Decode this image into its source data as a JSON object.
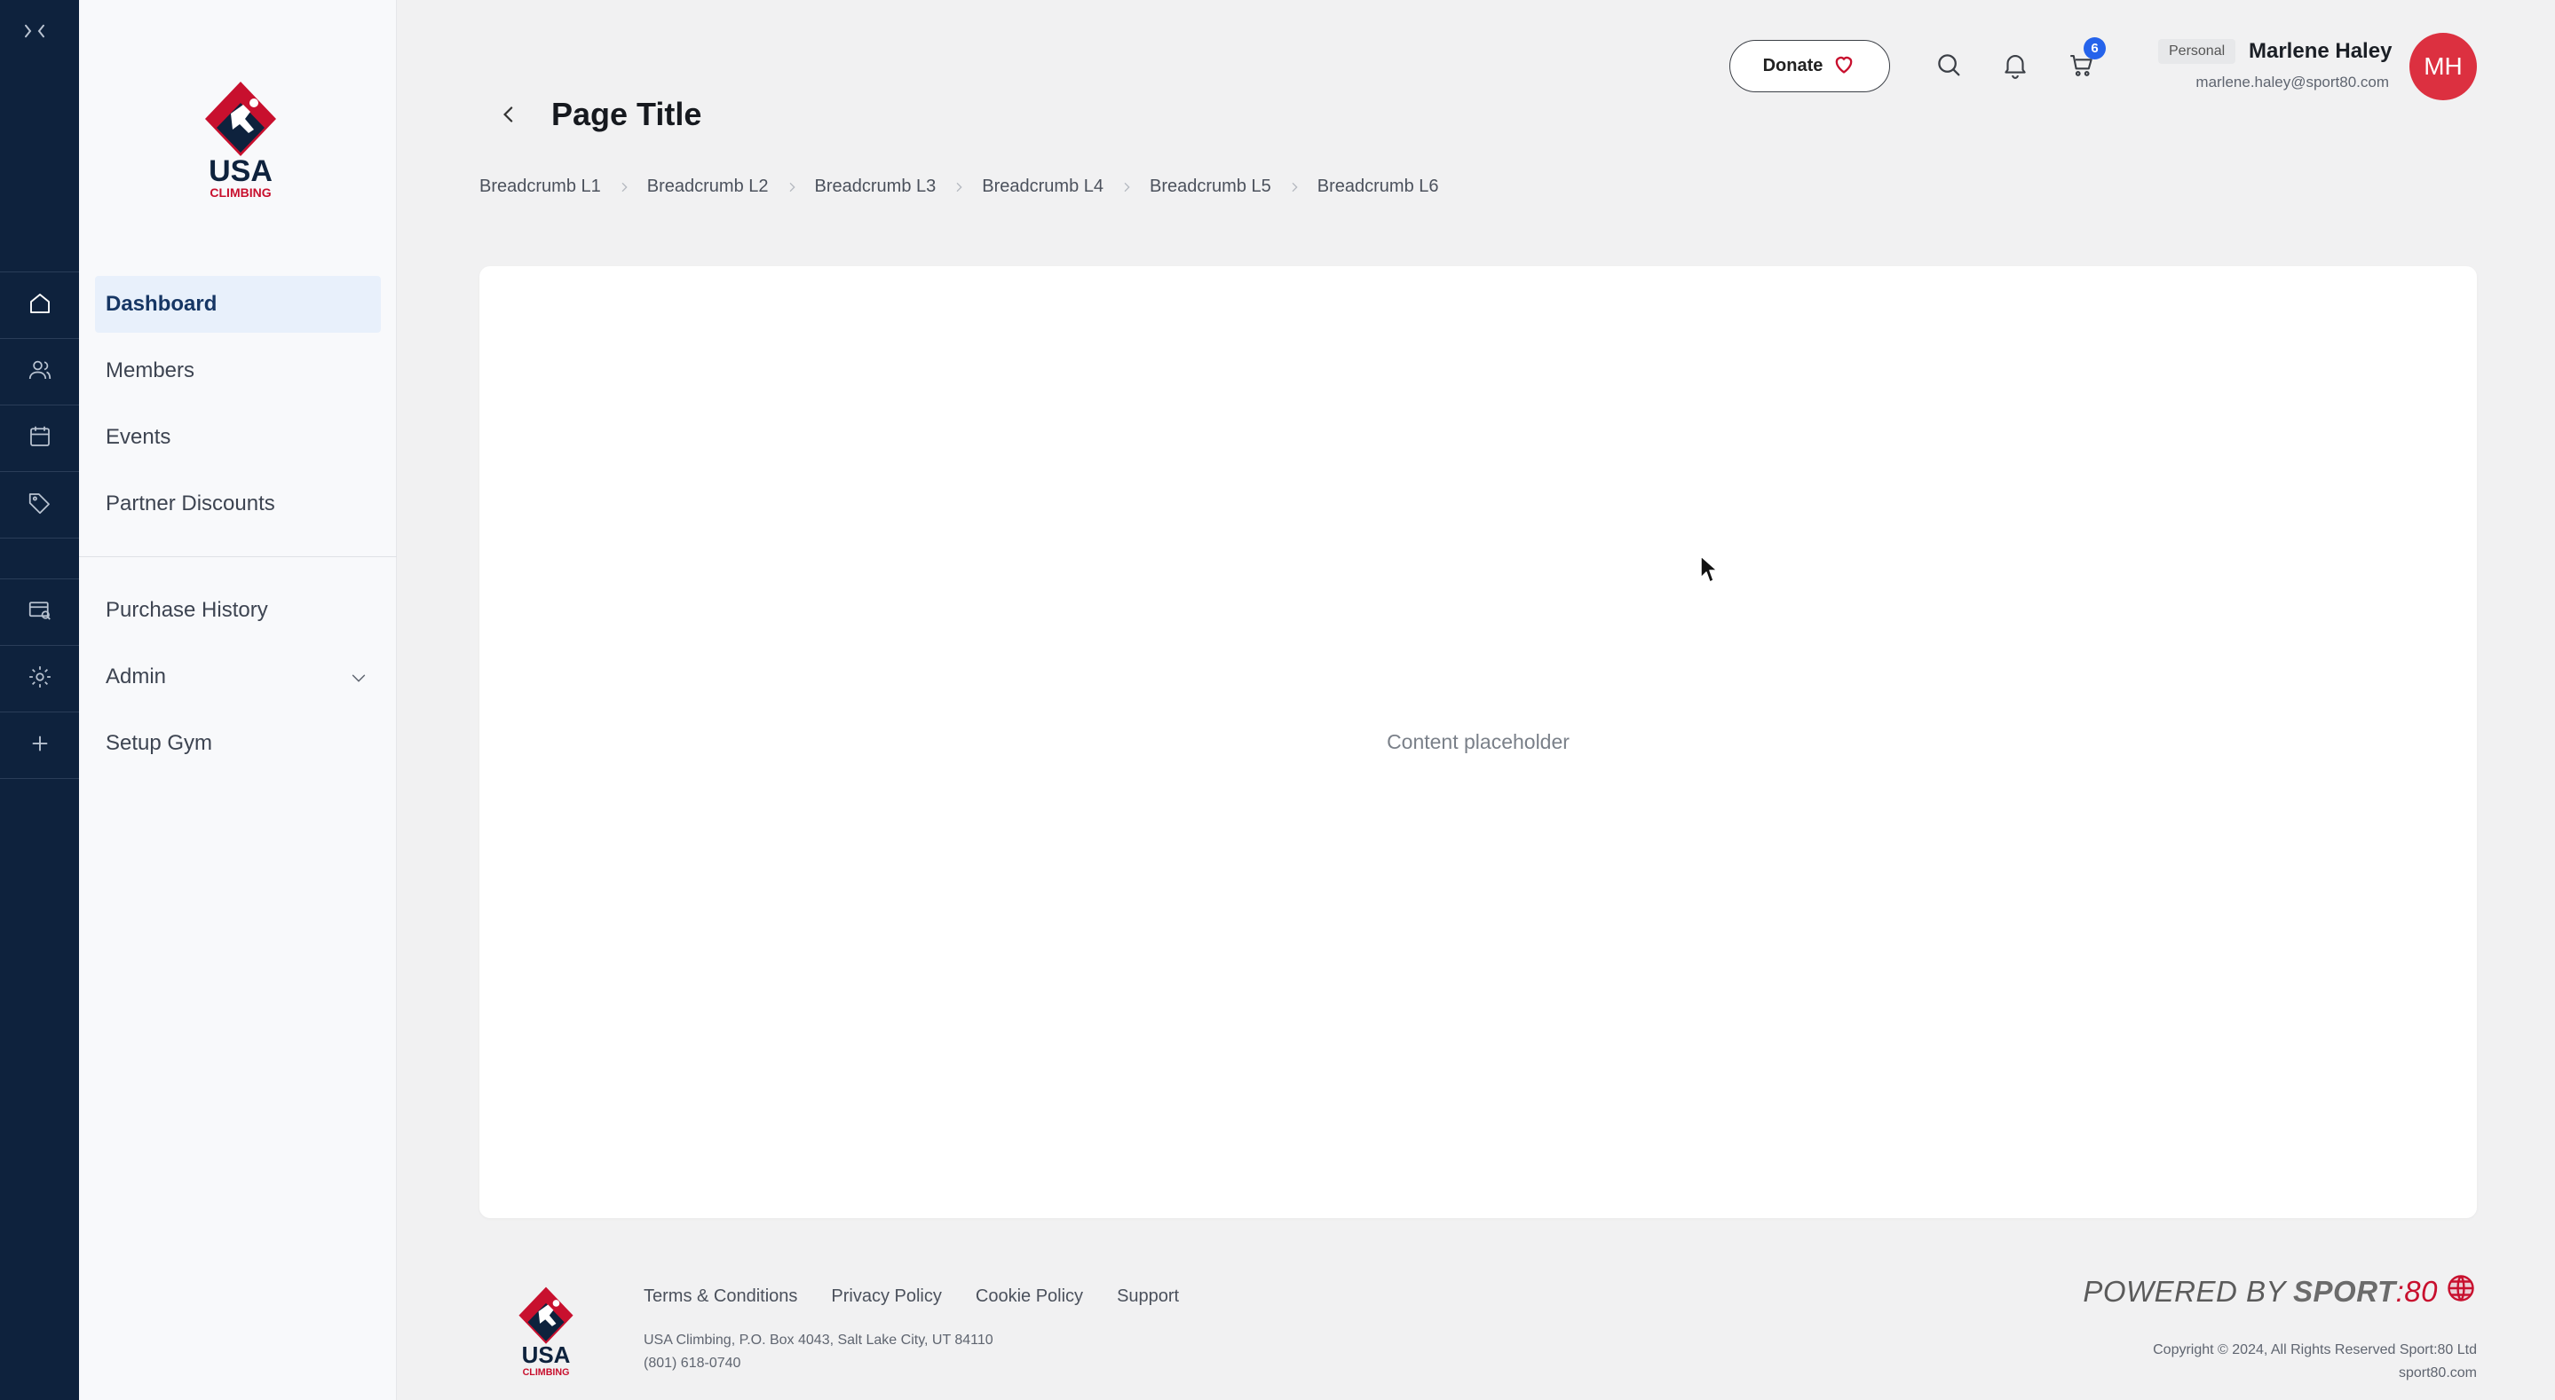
{
  "brand": {
    "logo_text_line1": "USA",
    "logo_text_line2": "CLIMBING",
    "primary_color": "#0e223d",
    "accent_color": "#c8102e"
  },
  "rail": {
    "icons": [
      "collapse-icon",
      "home-icon",
      "members-icon",
      "calendar-icon",
      "tag-icon",
      "receipt-search-icon",
      "gear-icon",
      "plus-icon"
    ]
  },
  "sidebar": {
    "items": [
      {
        "label": "Dashboard",
        "active": true
      },
      {
        "label": "Members"
      },
      {
        "label": "Events"
      },
      {
        "label": "Partner Discounts"
      },
      {
        "label": "Purchase History"
      },
      {
        "label": "Admin",
        "has_chevron": true
      },
      {
        "label": "Setup Gym"
      }
    ]
  },
  "header": {
    "donate_label": "Donate",
    "cart_count": "6",
    "account_type": "Personal",
    "user_name": "Marlene Haley",
    "user_email": "marlene.haley@sport80.com",
    "avatar_initials": "MH"
  },
  "page": {
    "title": "Page Title",
    "breadcrumbs": [
      "Breadcrumb L1",
      "Breadcrumb L2",
      "Breadcrumb L3",
      "Breadcrumb L4",
      "Breadcrumb L5",
      "Breadcrumb L6"
    ],
    "content_placeholder": "Content placeholder"
  },
  "footer": {
    "links": [
      "Terms & Conditions",
      "Privacy Policy",
      "Cookie Policy",
      "Support"
    ],
    "address_line1": "USA Climbing, P.O. Box 4043, Salt Lake City, UT 84110",
    "address_line2": "(801) 618-0740",
    "powered_prefix": "POWERED BY",
    "powered_brand": "SPORT",
    "powered_suffix": ":80",
    "copyright": "Copyright © 2024, All Rights Reserved Sport:80 Ltd",
    "site": "sport80.com"
  }
}
